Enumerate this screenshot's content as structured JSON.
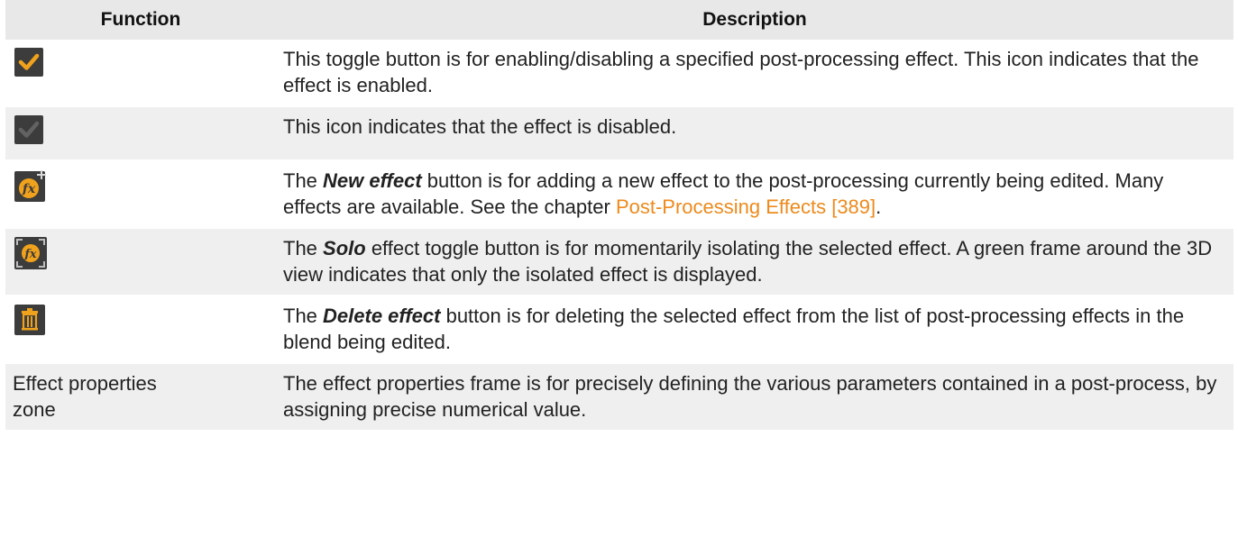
{
  "header": {
    "function": "Function",
    "description": "Description"
  },
  "rows": [
    {
      "icon": "checkmark-enabled-icon",
      "desc": "This toggle button is for enabling/disabling a specified post-processing effect. This icon indicates that the effect is enabled."
    },
    {
      "icon": "checkmark-disabled-icon",
      "desc": "This icon indicates that the effect is disabled."
    },
    {
      "icon": "new-effect-fx-plus-icon",
      "desc_pre": "The ",
      "desc_em": "New effect",
      "desc_mid": " button is for adding a new effect to the post-processing currently being edited. Many effects are available. See the chapter ",
      "desc_link": "Post-Processing Effects [389]",
      "desc_post": "."
    },
    {
      "icon": "solo-effect-fx-frame-icon",
      "desc_pre": "The ",
      "desc_em": "Solo",
      "desc_post": " effect toggle button is for momentarily isolating the selected effect. A green frame around the 3D view indicates that only the isolated effect is displayed."
    },
    {
      "icon": "delete-trash-icon",
      "desc_pre": "The ",
      "desc_em": "Delete effect",
      "desc_post": " button is for deleting the selected effect from the list of post-processing effects in the blend being edited."
    },
    {
      "function_text": "Effect properties zone",
      "desc": "The effect properties frame is for precisely defining the various parameters contained in a post-process, by assigning precise numerical value."
    }
  ],
  "colors": {
    "accent": "#f0a21c",
    "link": "#ee8a1d",
    "icon_bg": "#3c3c3c",
    "header_bg": "#e8e8e8",
    "row_alt_bg": "#efefef"
  }
}
